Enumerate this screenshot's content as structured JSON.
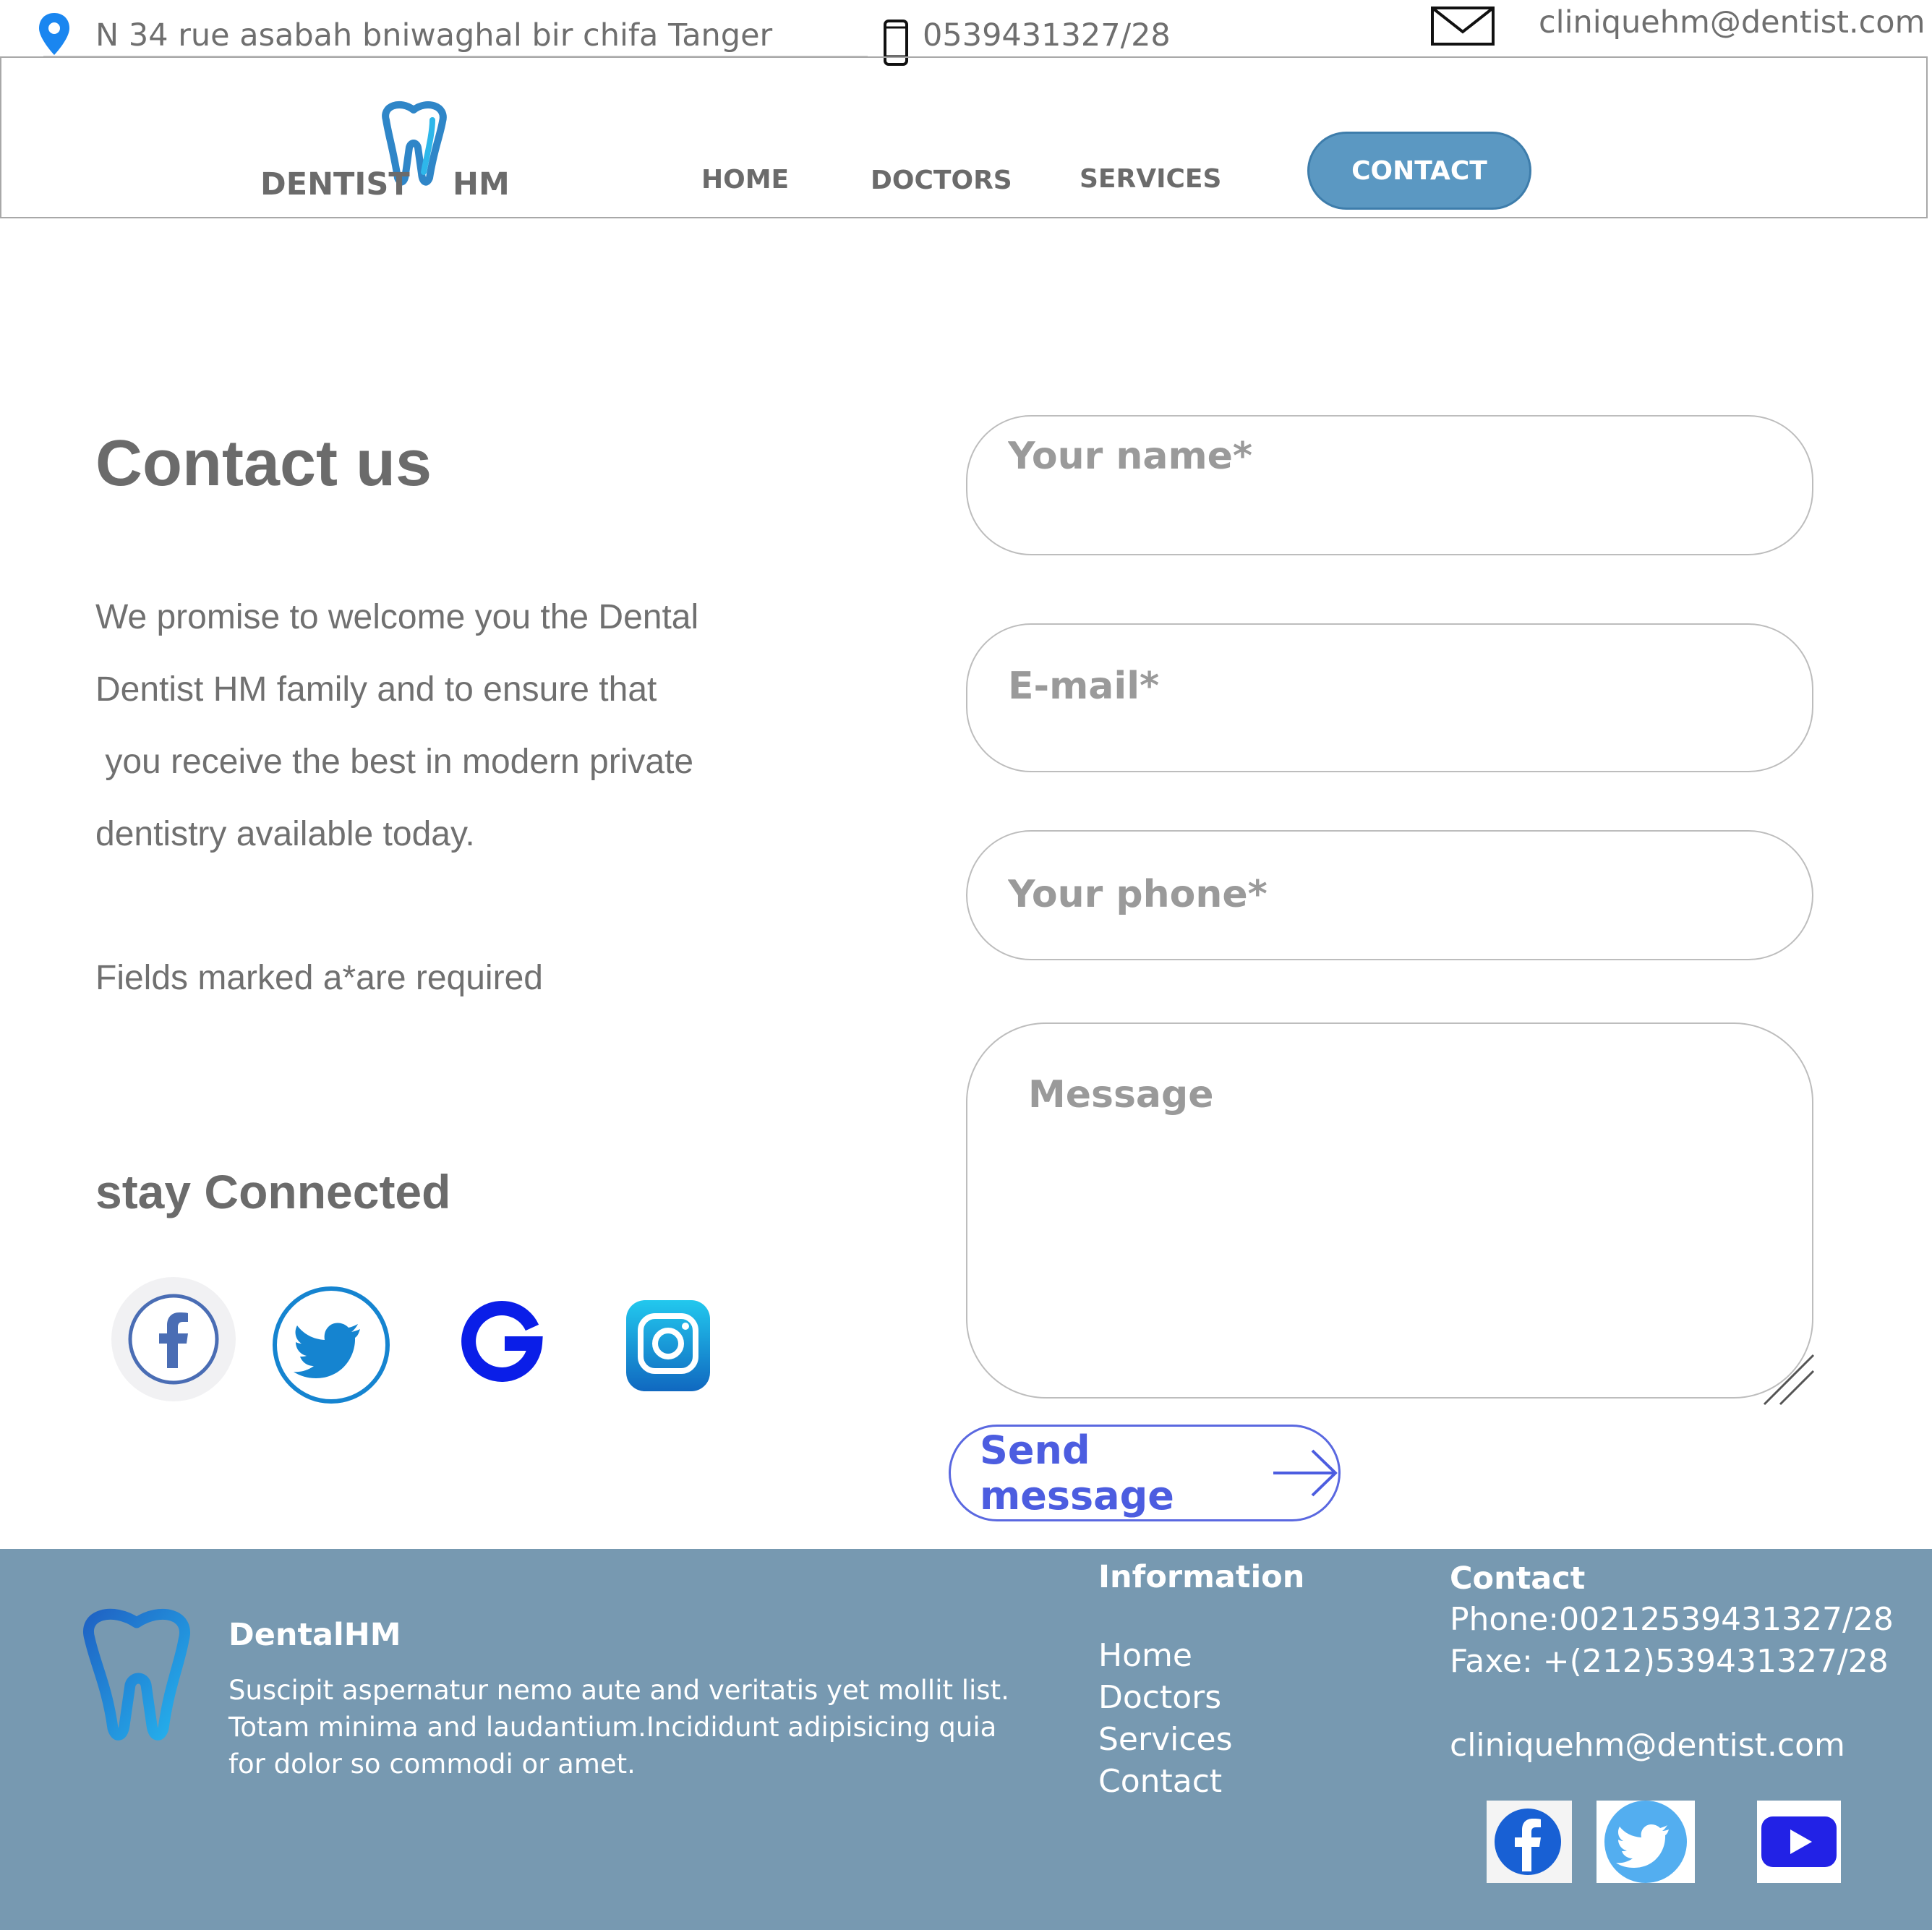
{
  "topbar": {
    "address": "N 34 rue asabah bniwaghal bir chifa Tanger",
    "phone": "0539431327/28",
    "email": "cliniquehm@dentist.com"
  },
  "header": {
    "logo_left": "DENTIST",
    "logo_right": "HM",
    "nav": {
      "home": "HOME",
      "doctors": "DOCTORS",
      "services": "SERVICES",
      "contact": "CONTACT"
    }
  },
  "main": {
    "title": "Contact us",
    "intro_lines": [
      "We promise to welcome you the Dental",
      "Dentist HM family and to ensure that",
      " you receive the best in modern private",
      "dentistry available today."
    ],
    "required_note": "Fields marked a*are required",
    "stay_connected": "stay Connected",
    "social": [
      "facebook-icon",
      "twitter-icon",
      "google-icon",
      "instagram-icon"
    ]
  },
  "form": {
    "name_placeholder": "Your name*",
    "email_placeholder": "E-mail*",
    "phone_placeholder": "Your phone*",
    "message_placeholder": "Message",
    "send_label": "Send message"
  },
  "footer": {
    "brand": "DentalHM",
    "description_lines": [
      "Suscipit aspernatur nemo aute and veritatis yet mollit list.",
      "Totam minima and laudantium.Incididunt adipisicing quia",
      "for dolor so commodi or amet."
    ],
    "info_title": "Information",
    "links": [
      "Home",
      "Doctors",
      "Services",
      "Contact"
    ],
    "contact_title": "Contact",
    "phone": "Phone:00212539431327/28",
    "fax": "Faxe: +(212)539431327/28",
    "email": "cliniquehm@dentist.com",
    "social": [
      "facebook-icon",
      "twitter-icon",
      "youtube-icon"
    ]
  },
  "colors": {
    "accent": "#5b98c2",
    "footer_bg": "#7799b1",
    "send_button": "#4c5de0"
  }
}
